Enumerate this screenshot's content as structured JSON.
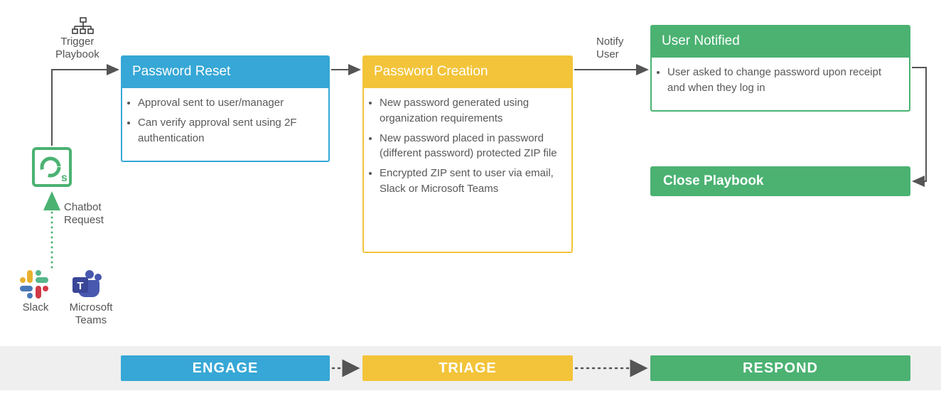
{
  "labels": {
    "trigger_playbook": "Trigger\nPlaybook",
    "chatbot_request": "Chatbot\nRequest",
    "notify_user": "Notify\nUser",
    "slack": "Slack",
    "teams": "Microsoft\nTeams"
  },
  "cards": {
    "password_reset": {
      "title": "Password Reset",
      "items": [
        "Approval sent to user/manager",
        "Can verify approval sent using 2F authentication"
      ]
    },
    "password_creation": {
      "title": "Password Creation",
      "items": [
        "New password generated using organization requirements",
        "New password placed in password (different password) protected ZIP file",
        "Encrypted ZIP sent to user via email, Slack or Microsoft Teams"
      ]
    },
    "user_notified": {
      "title": "User Notified",
      "items": [
        "User asked to change password upon receipt and when they log in"
      ]
    }
  },
  "close_playbook": "Close Playbook",
  "phases": {
    "engage": "ENGAGE",
    "triage": "TRIAGE",
    "respond": "RESPOND"
  },
  "colors": {
    "blue": "#36a7d6",
    "yellow": "#f3c43a",
    "green": "#4bb272",
    "grey": "#555555"
  }
}
